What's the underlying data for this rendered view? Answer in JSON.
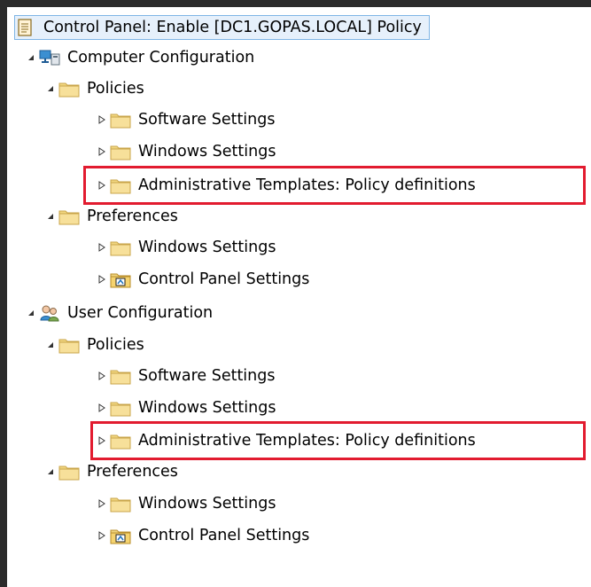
{
  "root": {
    "label": "Control Panel: Enable [DC1.GOPAS.LOCAL] Policy",
    "icon": "policy-document-icon"
  },
  "computer_configuration": {
    "label": "Computer Configuration",
    "icon": "computer-configuration-icon",
    "policies": {
      "label": "Policies",
      "software_settings": "Software Settings",
      "windows_settings": "Windows Settings",
      "administrative_templates": "Administrative Templates: Policy definitions"
    },
    "preferences": {
      "label": "Preferences",
      "windows_settings": "Windows Settings",
      "control_panel_settings": "Control Panel Settings"
    }
  },
  "user_configuration": {
    "label": "User Configuration",
    "icon": "user-configuration-icon",
    "policies": {
      "label": "Policies",
      "software_settings": "Software Settings",
      "windows_settings": "Windows Settings",
      "administrative_templates": "Administrative Templates: Policy definitions"
    },
    "preferences": {
      "label": "Preferences",
      "windows_settings": "Windows Settings",
      "control_panel_settings": "Control Panel Settings"
    }
  },
  "colors": {
    "highlight": "#e21b2f",
    "selection": "#e6f0fb",
    "folder": "#f1d680"
  }
}
